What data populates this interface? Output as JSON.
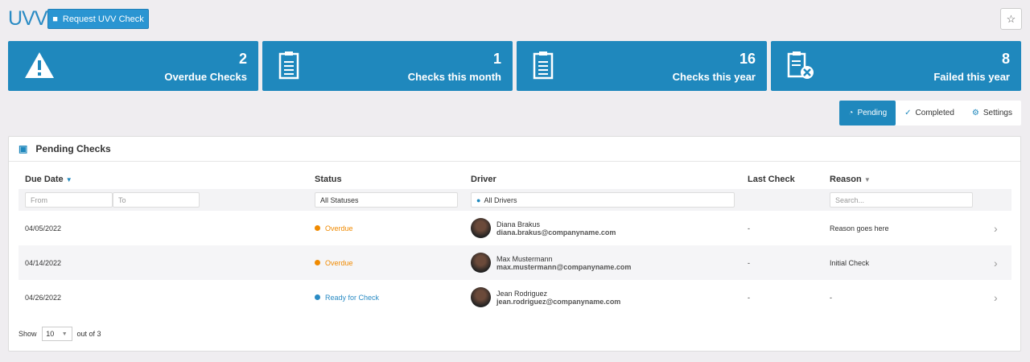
{
  "header": {
    "title": "UVV",
    "request_button": "Request UVV Check"
  },
  "stats": [
    {
      "value": "2",
      "label": "Overdue Checks",
      "icon": "warning-icon"
    },
    {
      "value": "1",
      "label": "Checks this month",
      "icon": "clipboard-icon"
    },
    {
      "value": "16",
      "label": "Checks this year",
      "icon": "clipboard-icon"
    },
    {
      "value": "8",
      "label": "Failed this year",
      "icon": "clipboard-failed-icon"
    }
  ],
  "tabs": [
    {
      "label": "Pending",
      "active": true
    },
    {
      "label": "Completed"
    },
    {
      "label": "Settings"
    }
  ],
  "panel": {
    "title": "Pending Checks"
  },
  "columns": [
    "Due Date",
    "Status",
    "Driver",
    "Last Check",
    "Reason"
  ],
  "filters": {
    "from": "From",
    "to": "To",
    "status": "All Statuses",
    "driver": "All Drivers",
    "search": "Search..."
  },
  "rows": [
    {
      "due": "04/05/2022",
      "status": "Overdue",
      "status_color": "#f08a00",
      "name": "Diana Brakus",
      "email": "diana.brakus@companyname.com",
      "last": "-",
      "reason": "Reason goes here"
    },
    {
      "due": "04/14/2022",
      "status": "Overdue",
      "status_color": "#f08a00",
      "name": "Max Mustermann",
      "email": "max.mustermann@companyname.com",
      "last": "-",
      "reason": "Initial Check"
    },
    {
      "due": "04/26/2022",
      "status": "Ready for Check",
      "status_color": "#2a8bc4",
      "name": "Jean Rodriguez",
      "email": "jean.rodriguez@companyname.com",
      "last": "-",
      "reason": "-"
    }
  ],
  "footer": {
    "show": "Show",
    "page_size": "10",
    "out_of": "out of 3"
  }
}
